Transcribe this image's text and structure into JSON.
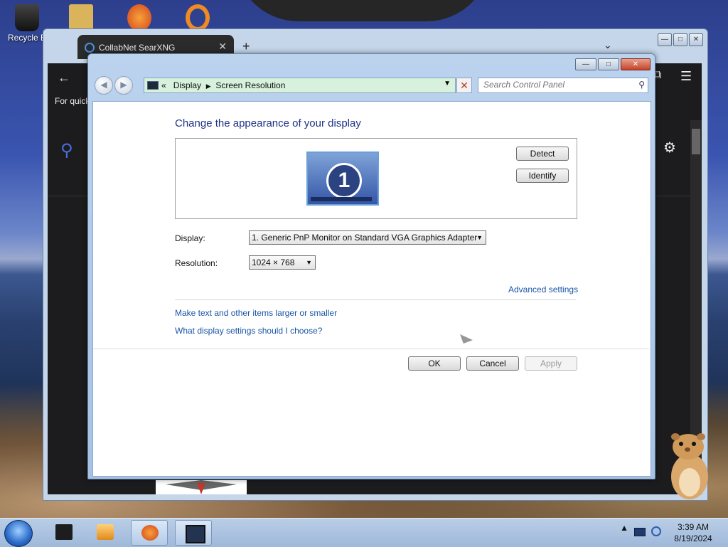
{
  "desktop": {
    "recycle_bin_label": "Recycle B"
  },
  "browser": {
    "tab_title": "CollabNet SearXNG",
    "tab_close": "✕",
    "new_tab": "+",
    "tab_list": "⌄",
    "back": "←",
    "quick_text": "For quick",
    "window_buttons": [
      "—",
      "□",
      "✕"
    ]
  },
  "control_panel": {
    "title_buttons": [
      "—",
      "□",
      "✕"
    ],
    "breadcrumb": [
      "Display",
      "Screen Resolution"
    ],
    "breadcrumb_prefix": "«",
    "search_placeholder": "Search Control Panel",
    "heading": "Change the appearance of your display",
    "monitor_number": "1",
    "detect_label": "Detect",
    "identify_label": "Identify",
    "display_label": "Display:",
    "display_value": "1. Generic PnP Monitor on Standard VGA Graphics Adapter",
    "resolution_label": "Resolution:",
    "resolution_value": "1024 × 768",
    "advanced_link": "Advanced settings",
    "larger_text_link": "Make text and other items larger or smaller",
    "which_settings_link": "What display settings should I choose?",
    "ok_label": "OK",
    "cancel_label": "Cancel",
    "apply_label": "Apply"
  },
  "taskbar": {
    "time": "3:39 AM",
    "date": "8/19/2024",
    "tray_arrow": "▲"
  },
  "icons": {
    "back": "back-arrow-icon",
    "forward": "forward-arrow-icon",
    "search": "magnifier-icon",
    "settings": "gear-icon"
  },
  "colors": {
    "link": "#1a55a6",
    "heading": "#1e3287",
    "address_bar_bg": "#d7f1dc"
  }
}
